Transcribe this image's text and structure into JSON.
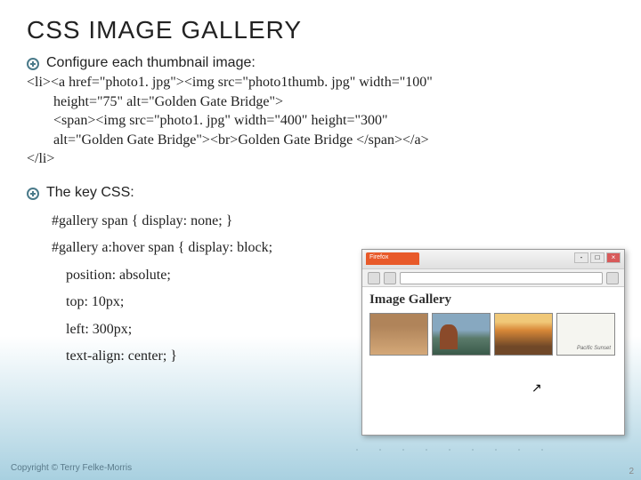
{
  "title": "CSS IMAGE GALLERY",
  "bullet1": "Configure each thumbnail image:",
  "code1_line1": "<li><a href=\"photo1. jpg\"><img src=\"photo1thumb. jpg\"   width=\"100\"",
  "code1_line2": "height=\"75\" alt=\"Golden Gate Bridge\">",
  "code1_line3": "<span><img src=\"photo1. jpg\"  width=\"400\"  height=\"300\"",
  "code1_line4": "alt=\"Golden Gate Bridge\"><br>Golden Gate Bridge </span></a>",
  "code1_line5": "</li>",
  "bullet2": "The key CSS:",
  "css_line1": "#gallery span { display: none; }",
  "css_line2": "#gallery a:hover span { display: block;",
  "css_line3": "position: absolute;",
  "css_line4": "top: 10px;",
  "css_line5": "left: 300px;",
  "css_line6": "text-align: center; }",
  "browser_tab": "Firefox",
  "gallery_heading": "Image Gallery",
  "footer": "Copyright © Terry Felke-Morris",
  "page_num": "2"
}
